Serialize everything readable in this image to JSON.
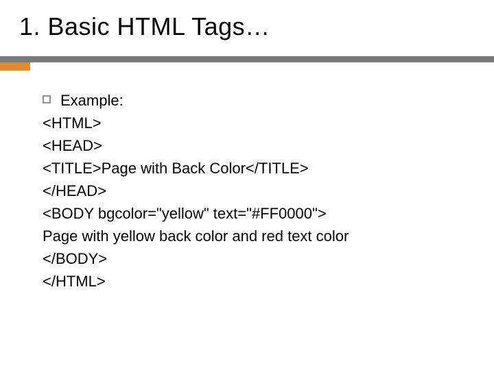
{
  "title": "1. Basic HTML Tags…",
  "bullet_label": "Example:",
  "code_lines": [
    "<HTML>",
    "<HEAD>",
    "<TITLE>Page with Back Color</TITLE>",
    "</HEAD>",
    "<BODY bgcolor=\"yellow\" text=\"#FF0000\">",
    "Page with yellow back color and red text color",
    "</BODY>",
    "</HTML>"
  ],
  "accent_color": "#e58a2c",
  "rule_color": "#7a7a7a"
}
